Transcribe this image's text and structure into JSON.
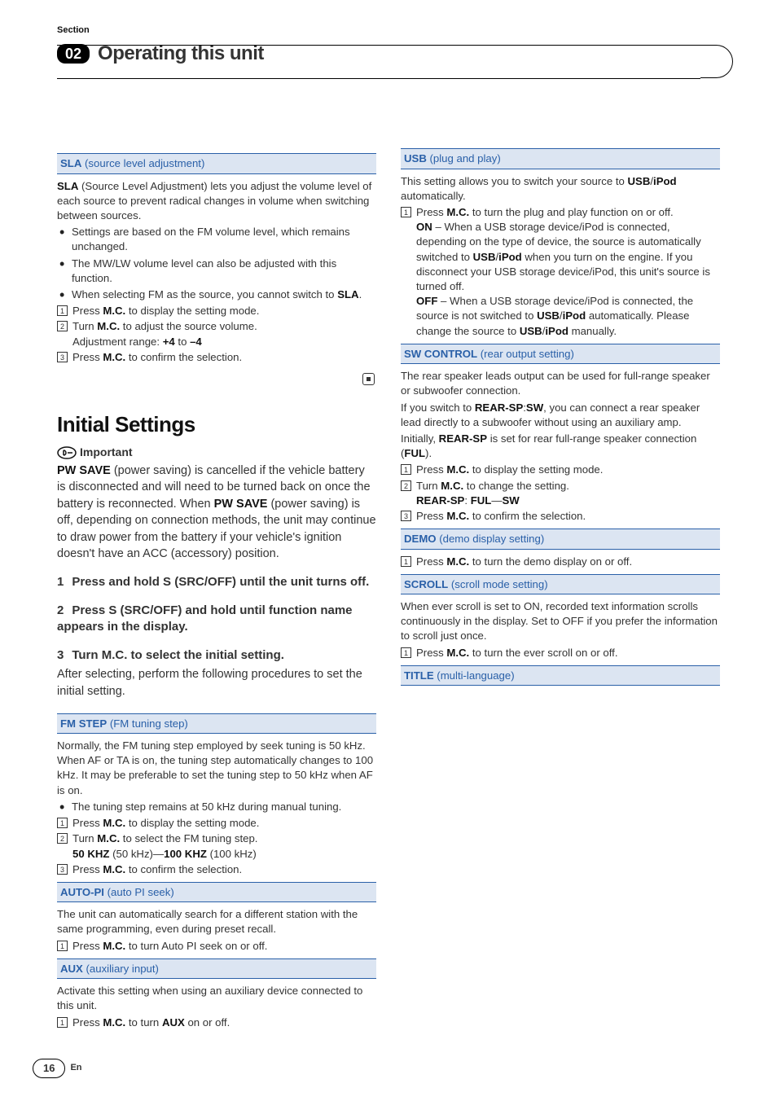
{
  "header": {
    "section_label": "Section",
    "section_number": "02",
    "chapter_title": "Operating this unit"
  },
  "left": {
    "sla": {
      "bar_b": "SLA",
      "bar_n": " (source level adjustment)",
      "p1a": "SLA",
      "p1b": " (Source Level Adjustment) lets you adjust the volume level of each source to prevent radical changes in volume when switching between sources.",
      "b1": "Settings are based on the FM volume level, which remains unchanged.",
      "b2": "The MW/LW volume level can also be adjusted with this function.",
      "b3a": "When selecting FM as the source, you cannot switch to ",
      "b3b": "SLA",
      "b3c": ".",
      "s1a": "Press ",
      "s1b": "M.C.",
      "s1c": " to display the setting mode.",
      "s2a": "Turn ",
      "s2b": "M.C.",
      "s2c": " to adjust the source volume.",
      "s2d": "Adjustment range: ",
      "s2e": "+4",
      "s2f": " to ",
      "s2g": "–4",
      "s3a": "Press ",
      "s3b": "M.C.",
      "s3c": " to confirm the selection."
    },
    "init": {
      "title": "Initial Settings",
      "imp": "Important",
      "p1a": "PW SAVE",
      "p1b": " (power saving) is cancelled if the vehicle battery is disconnected and will need to be turned back on once the battery is reconnected. When ",
      "p1c": "PW SAVE",
      "p1d": " (power saving) is off, depending on connection methods, the unit may continue to draw power from the battery if your vehicle's ignition doesn't have an ACC (accessory) position.",
      "n1": "1",
      "t1": "Press and hold S (SRC/OFF) until the unit turns off.",
      "n2": "2",
      "t2": "Press S (SRC/OFF) and hold until function name appears in the display.",
      "n3": "3",
      "t3": "Turn M.C. to select the initial setting.",
      "after3": "After selecting, perform the following procedures to set the initial setting."
    },
    "fm": {
      "bar_b": "FM STEP",
      "bar_n": " (FM tuning step)",
      "p1": "Normally, the FM tuning step employed by seek tuning is 50 kHz. When AF or TA is on, the tuning step automatically changes to 100 kHz. It may be preferable to set the tuning step to 50 kHz when AF is on.",
      "b1": "The tuning step remains at 50 kHz during manual tuning.",
      "s1a": "Press ",
      "s1b": "M.C.",
      "s1c": " to display the setting mode.",
      "s2a": "Turn ",
      "s2b": "M.C.",
      "s2c": " to select the FM tuning step.",
      "s2d": "50 KHZ",
      "s2e": " (50 kHz)—",
      "s2f": "100 KHZ",
      "s2g": " (100 kHz)",
      "s3a": "Press ",
      "s3b": "M.C.",
      "s3c": " to confirm the selection."
    }
  },
  "right": {
    "autopi": {
      "bar_b": "AUTO-PI",
      "bar_n": " (auto PI seek)",
      "p1": "The unit can automatically search for a different station with the same programming, even during preset recall.",
      "s1a": "Press ",
      "s1b": "M.C.",
      "s1c": " to turn Auto PI seek on or off."
    },
    "aux": {
      "bar_b": "AUX",
      "bar_n": " (auxiliary input)",
      "p1": "Activate this setting when using an auxiliary device connected to this unit.",
      "s1a": "Press ",
      "s1b": "M.C.",
      "s1c": " to turn ",
      "s1d": "AUX",
      "s1e": " on or off."
    },
    "usb": {
      "bar_b": "USB",
      "bar_n": " (plug and play)",
      "p1a": "This setting allows you to switch your source to ",
      "p1b": "USB",
      "p1c": "/",
      "p1d": "iPod",
      "p1e": " automatically.",
      "s1a": "Press ",
      "s1b": "M.C.",
      "s1c": " to turn the plug and play function on or off.",
      "on_b": "ON",
      "on_t1": " – When a USB storage device/iPod is connected, depending on the type of device, the source is automatically switched to  ",
      "on_t2": "USB",
      "on_t3": "/",
      "on_t4": "iPod",
      "on_t5": " when you turn on the engine. If you disconnect your USB storage device/iPod, this unit's source is turned off.",
      "off_b": "OFF",
      "off_t1": " – When a USB storage device/iPod is connected, the source is not switched to ",
      "off_t2": "USB",
      "off_t3": "/",
      "off_t4": "iPod",
      "off_t5": " automatically. Please change the source to ",
      "off_t6": "USB",
      "off_t7": "/",
      "off_t8": "iPod",
      "off_t9": " manually."
    },
    "sw": {
      "bar_b": "SW CONTROL",
      "bar_n": " (rear output setting)",
      "p1": "The rear speaker leads output can be used for full-range speaker or subwoofer connection.",
      "p2a": "If you switch to ",
      "p2b": "REAR-SP",
      "p2c": ":",
      "p2d": "SW",
      "p2e": ", you can connect a rear speaker lead directly to a subwoofer without using an auxiliary amp.",
      "p3a": "Initially, ",
      "p3b": "REAR-SP",
      "p3c": " is set for rear full-range speaker connection (",
      "p3d": "FUL",
      "p3e": ").",
      "s1a": "Press ",
      "s1b": "M.C.",
      "s1c": " to display the setting mode.",
      "s2a": "Turn ",
      "s2b": "M.C.",
      "s2c": " to change the setting.",
      "s2d": "REAR-SP",
      "s2e": ": ",
      "s2f": "FUL",
      "s2g": "—",
      "s2h": "SW",
      "s3a": "Press ",
      "s3b": "M.C.",
      "s3c": " to confirm the selection."
    },
    "demo": {
      "bar_b": "DEMO",
      "bar_n": " (demo display setting)",
      "s1a": "Press ",
      "s1b": "M.C.",
      "s1c": " to turn the demo display on or off."
    },
    "scroll": {
      "bar_b": "SCROLL",
      "bar_n": " (scroll mode setting)",
      "p1": "When ever scroll is set to ON, recorded text information scrolls continuously in the display. Set to OFF if you prefer the information to scroll just once.",
      "s1a": "Press ",
      "s1b": "M.C.",
      "s1c": " to turn the ever scroll on or off."
    },
    "title": {
      "bar_b": "TITLE",
      "bar_n": " (multi-language)"
    }
  },
  "footer": {
    "page": "16",
    "lang": "En"
  }
}
